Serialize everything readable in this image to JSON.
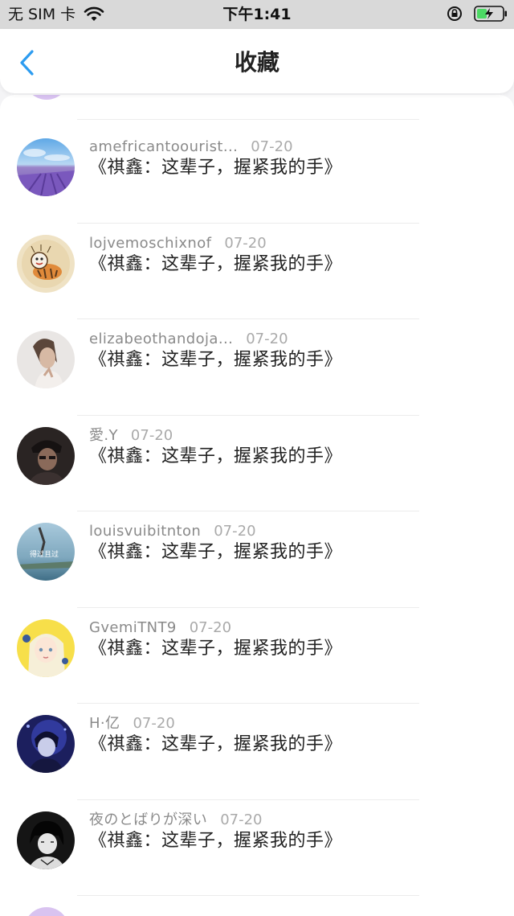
{
  "status_bar": {
    "carrier": "无 SIM 卡",
    "time": "下午1:41"
  },
  "nav": {
    "title": "收藏"
  },
  "items": [
    {
      "name": "amefricantoourist...",
      "date": "07-20",
      "title": "《祺鑫：这辈子，握紧我的手》",
      "avatar_icon": "lavender-field-avatar"
    },
    {
      "name": "lojvemoschixnof",
      "date": "07-20",
      "title": "《祺鑫：这辈子，握紧我的手》",
      "avatar_icon": "cartoon-tiger-avatar"
    },
    {
      "name": "elizabeothandoja...",
      "date": "07-20",
      "title": "《祺鑫：这辈子，握紧我的手》",
      "avatar_icon": "portrait-photo-avatar"
    },
    {
      "name": "愛.Y",
      "date": "07-20",
      "title": "《祺鑫：这辈子，握紧我的手》",
      "avatar_icon": "dark-portrait-avatar"
    },
    {
      "name": "louisvuibitnton",
      "date": "07-20",
      "title": "《祺鑫：这辈子，握紧我的手》",
      "avatar_icon": "seaside-scene-avatar",
      "avatar_text": "得过且过"
    },
    {
      "name": "GvemiTNT9",
      "date": "07-20",
      "title": "《祺鑫：这辈子，握紧我的手》",
      "avatar_icon": "anime-girl-avatar"
    },
    {
      "name": "H·亿",
      "date": "07-20",
      "title": "《祺鑫：这辈子，握紧我的手》",
      "avatar_icon": "blue-night-avatar"
    },
    {
      "name": "夜のとばりが深い",
      "date": "07-20",
      "title": "《祺鑫：这辈子，握紧我的手》",
      "avatar_icon": "monochrome-anime-avatar"
    }
  ],
  "colors": {
    "accent": "#2d9cf0",
    "title_text": "#222222",
    "meta_text": "#888888"
  }
}
